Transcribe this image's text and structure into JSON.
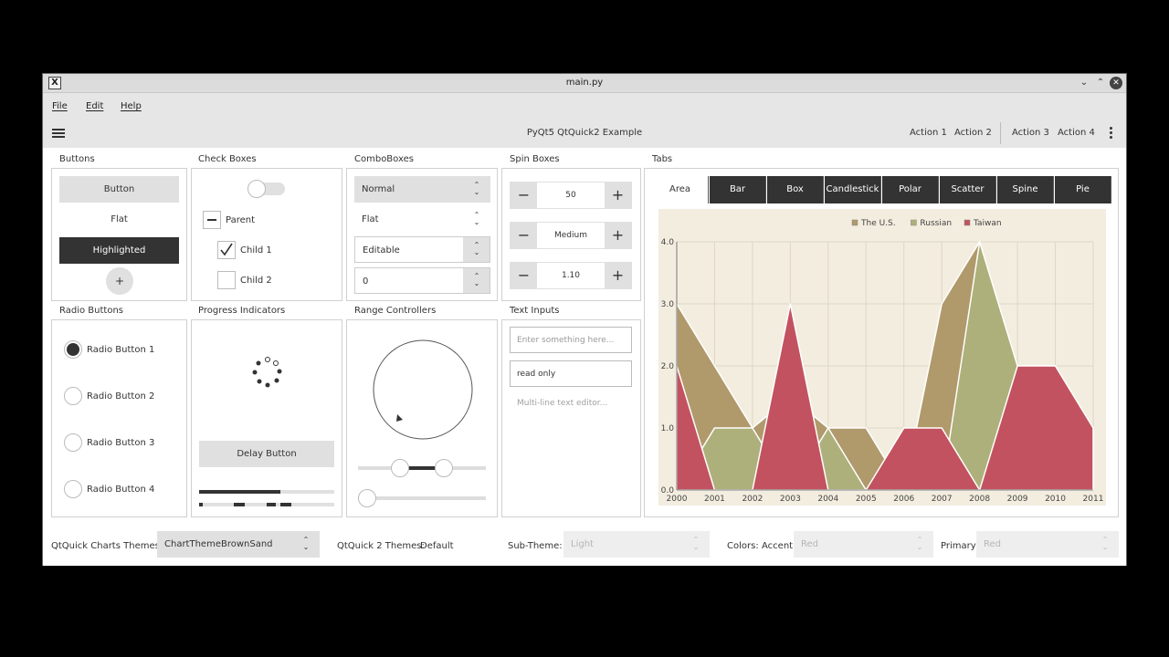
{
  "window": {
    "title": "main.py"
  },
  "menu": {
    "file": "File",
    "edit": "Edit",
    "help": "Help"
  },
  "toolbar": {
    "title": "PyQt5 QtQuick2 Example",
    "actions": [
      "Action 1",
      "Action 2",
      "Action 3",
      "Action 4"
    ]
  },
  "buttons": {
    "title": "Buttons",
    "button": "Button",
    "flat": "Flat",
    "highlighted": "Highlighted",
    "round": "+"
  },
  "checkboxes": {
    "title": "Check Boxes",
    "parent": "Parent",
    "child1": "Child 1",
    "child2": "Child 2",
    "switch_on": false
  },
  "comboboxes": {
    "title": "ComboBoxes",
    "normal": "Normal",
    "flat": "Flat",
    "editable": "Editable",
    "editable_value": "0"
  },
  "spinboxes": {
    "title": "Spin Boxes",
    "values": [
      "50",
      "Medium",
      "1.10"
    ]
  },
  "radios": {
    "title": "Radio Buttons",
    "items": [
      "Radio Button 1",
      "Radio Button 2",
      "Radio Button 3",
      "Radio Button 4"
    ],
    "selected": 0
  },
  "progress": {
    "title": "Progress Indicators",
    "delay_button": "Delay Button",
    "bar1": 0.6,
    "bar2_style": "indeterminate"
  },
  "range": {
    "title": "Range Controllers",
    "range_low": 0.3,
    "range_high": 0.7,
    "slider": 0.0
  },
  "textinputs": {
    "title": "Text Inputs",
    "placeholder1": "Enter something here...",
    "readonly": "read only",
    "multiline_placeholder": "Multi-line text editor..."
  },
  "tabs": {
    "title": "Tabs",
    "items": [
      "Area",
      "Bar",
      "Box",
      "Candlestick",
      "Polar",
      "Scatter",
      "Spine",
      "Pie"
    ],
    "active": 0
  },
  "bottom": {
    "charts_themes_label": "QtQuick Charts Themes:",
    "charts_theme_value": "ChartThemeBrownSand",
    "qq2_label": "QtQuick 2 Themes:",
    "qq2_value": "Default",
    "subtheme_label": "Sub-Theme:",
    "subtheme_value": "Light",
    "colors_label": "Colors:",
    "accent_label": "Accent",
    "accent_value": "Red",
    "primary_label": "Primary",
    "primary_value": "Red"
  },
  "colors": {
    "us": "#b0996b",
    "russian": "#adb07a",
    "taiwan": "#c2525f",
    "chart_bg": "#f3eddf",
    "dark": "#333333"
  },
  "chart_data": {
    "type": "area",
    "x": [
      2000,
      2001,
      2002,
      2003,
      2004,
      2005,
      2006,
      2007,
      2008,
      2009,
      2010,
      2011
    ],
    "series": [
      {
        "name": "The U.S.",
        "values": [
          3,
          2,
          1,
          1.5,
          1,
          1,
          0,
          3,
          4,
          0,
          0,
          0
        ]
      },
      {
        "name": "Russian",
        "values": [
          0,
          1,
          1,
          0,
          1,
          0,
          0,
          0,
          4,
          2,
          2,
          1
        ]
      },
      {
        "name": "Taiwan",
        "values": [
          2,
          0,
          0,
          3,
          0,
          0,
          1,
          1,
          0,
          2,
          2,
          1
        ]
      }
    ],
    "xlim": [
      2000,
      2011
    ],
    "ylim": [
      0,
      4
    ],
    "yticks": [
      "0.0",
      "1.0",
      "2.0",
      "3.0",
      "4.0"
    ],
    "xticks": [
      "2000",
      "2001",
      "2002",
      "2003",
      "2004",
      "2005",
      "2006",
      "2007",
      "2008",
      "2009",
      "2010",
      "2011"
    ],
    "legend": "top-center",
    "grid": true
  }
}
